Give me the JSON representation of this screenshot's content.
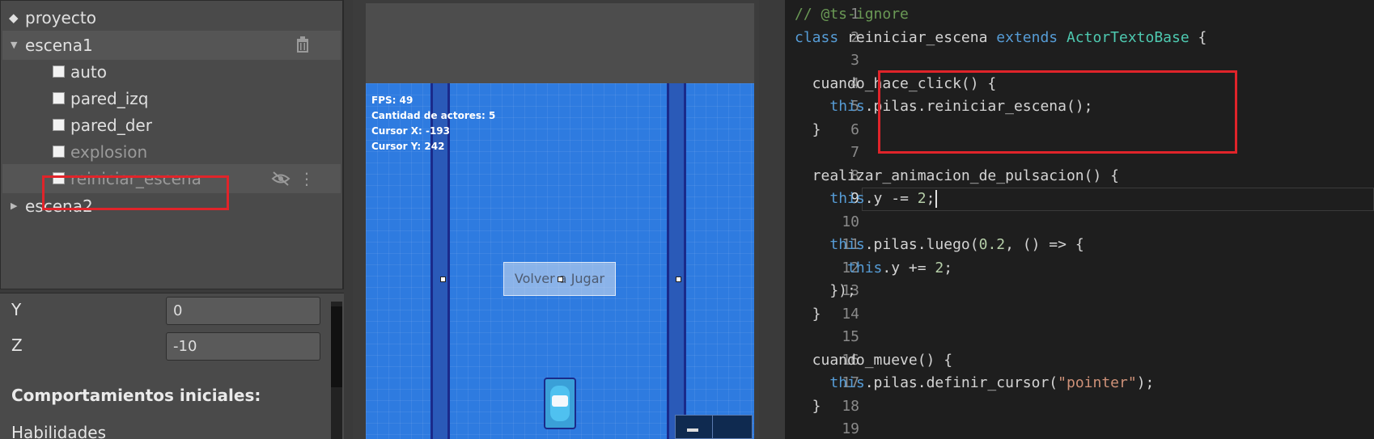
{
  "tree": {
    "items": [
      {
        "label": "proyecto",
        "kind": "project"
      },
      {
        "label": "escena1",
        "kind": "scene",
        "expanded": true
      },
      {
        "label": "auto",
        "kind": "actor"
      },
      {
        "label": "pared_izq",
        "kind": "actor"
      },
      {
        "label": "pared_der",
        "kind": "actor"
      },
      {
        "label": "explosion",
        "kind": "actor",
        "dimmed": true
      },
      {
        "label": "reiniciar_escena",
        "kind": "actor",
        "dimmed": true,
        "selected": true
      },
      {
        "label": "escena2",
        "kind": "scene",
        "expanded": false
      }
    ],
    "icons": {
      "project": "diamond-icon",
      "delete": "trash-icon",
      "hidden": "eye-slash-icon",
      "menu": "kebab-menu-icon"
    }
  },
  "properties": {
    "y_label": "Y",
    "y_value": "0",
    "z_label": "Z",
    "z_value": "-10",
    "behaviors_title": "Comportamientos iniciales:",
    "abilities_label": "Habilidades"
  },
  "canvas": {
    "hud": [
      "FPS: 49",
      "Cantidad de actores: 5",
      "Cursor X: -193",
      "Cursor Y: 242"
    ],
    "button_label": "Volver a Jugar"
  },
  "editor": {
    "current_line": 9,
    "lines": [
      {
        "n": "1",
        "text": "// @ts-ignore"
      },
      {
        "n": "2",
        "text": "class reiniciar_escena extends ActorTextoBase {"
      },
      {
        "n": "3",
        "text": ""
      },
      {
        "n": "4",
        "text": "  cuando_hace_click() {"
      },
      {
        "n": "5",
        "text": "    this.pilas.reiniciar_escena();"
      },
      {
        "n": "6",
        "text": "  }"
      },
      {
        "n": "7",
        "text": ""
      },
      {
        "n": "8",
        "text": "  realizar_animacion_de_pulsacion() {"
      },
      {
        "n": "9",
        "text": "    this.y -= 2;"
      },
      {
        "n": "10",
        "text": ""
      },
      {
        "n": "11",
        "text": "    this.pilas.luego(0.2, () => {"
      },
      {
        "n": "12",
        "text": "      this.y += 2;"
      },
      {
        "n": "13",
        "text": "    });"
      },
      {
        "n": "14",
        "text": "  }"
      },
      {
        "n": "15",
        "text": ""
      },
      {
        "n": "16",
        "text": "  cuando_mueve() {"
      },
      {
        "n": "17",
        "text": "    this.pilas.definir_cursor(\"pointer\");"
      },
      {
        "n": "18",
        "text": "  }"
      },
      {
        "n": "19",
        "text": ""
      }
    ]
  },
  "colors": {
    "highlight": "#e0242a",
    "canvas": "#2e7be0",
    "keyword": "#569cd6",
    "class": "#4ec9b0",
    "comment": "#6a9955",
    "number": "#b5cea8",
    "string": "#ce9178"
  }
}
